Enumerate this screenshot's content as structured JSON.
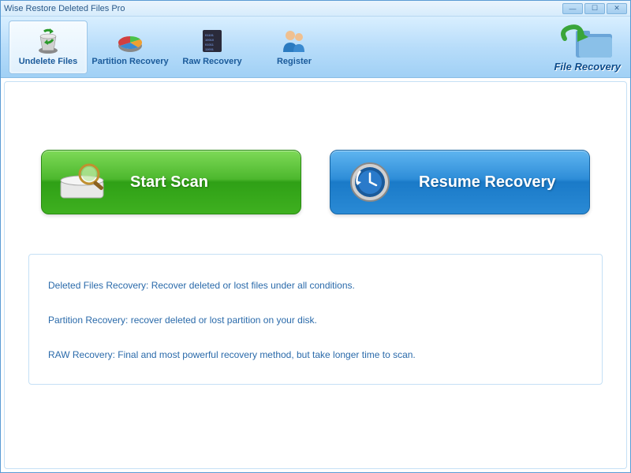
{
  "window": {
    "title": "Wise Restore Deleted Files Pro"
  },
  "toolbar": {
    "items": [
      {
        "label": "Undelete Files"
      },
      {
        "label": "Partition Recovery"
      },
      {
        "label": "Raw Recovery"
      },
      {
        "label": "Register"
      }
    ]
  },
  "brand": {
    "label": "File Recovery"
  },
  "actions": {
    "scan": "Start  Scan",
    "resume": "Resume Recovery"
  },
  "info": {
    "line1": "Deleted Files Recovery: Recover deleted or lost files  under all conditions.",
    "line2": "Partition Recovery: recover deleted or lost partition on your disk.",
    "line3": "RAW Recovery: Final and most powerful recovery method, but take longer time to scan."
  }
}
